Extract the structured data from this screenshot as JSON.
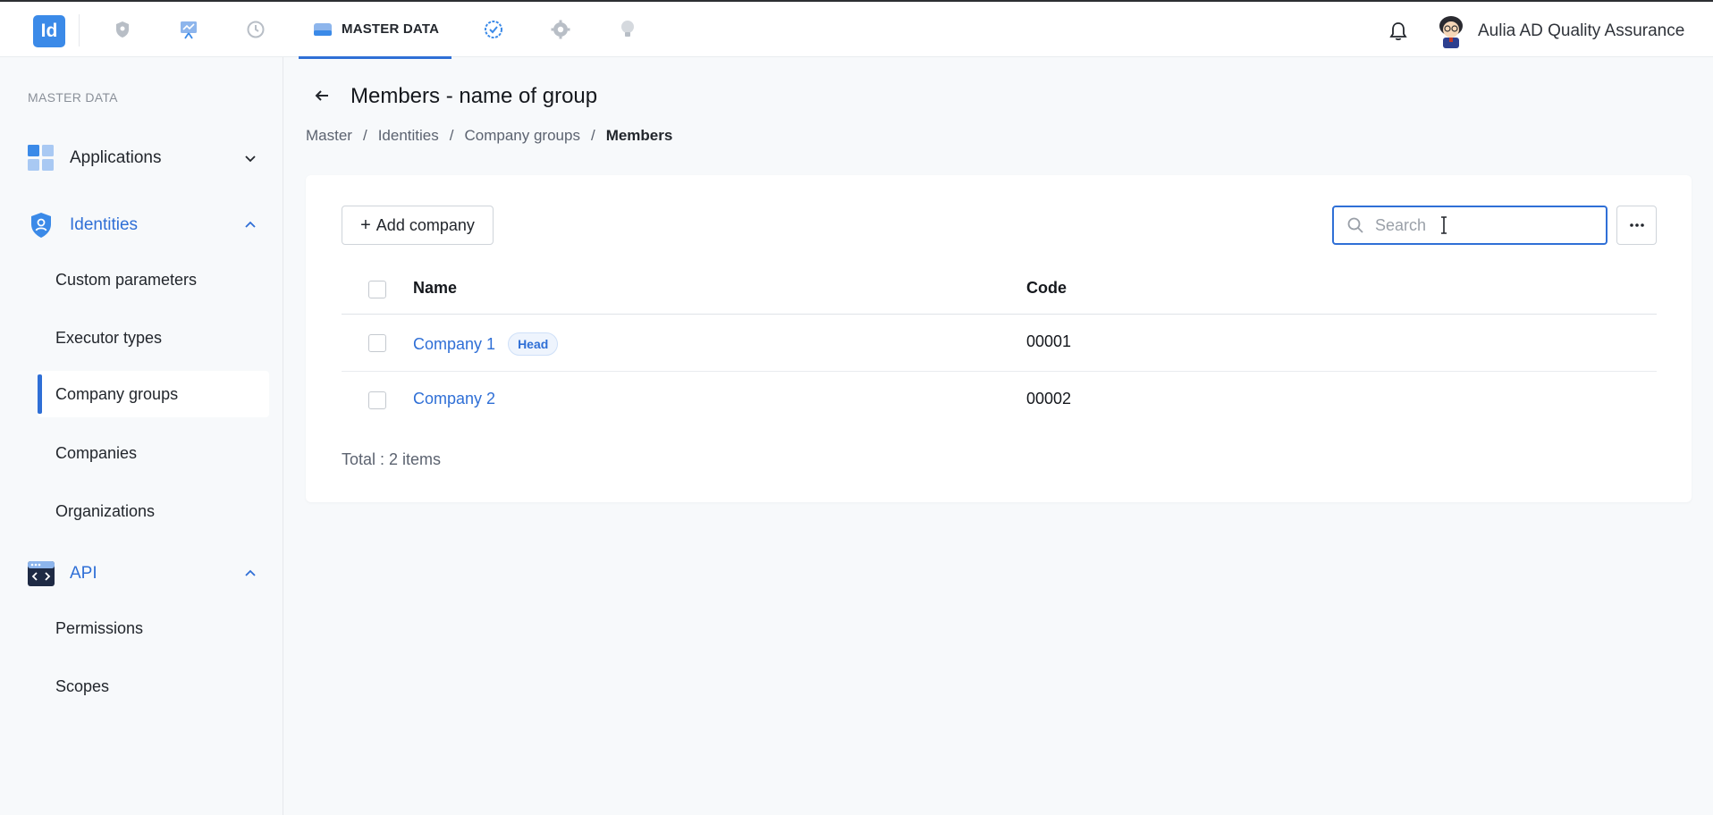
{
  "app": {
    "logo_text": "Id",
    "brand_color": "#3b8ae8",
    "accent_color": "#2f6fd6"
  },
  "topnav": {
    "icons": [
      "security-shield-icon",
      "dashboard-chart-icon",
      "history-clock-icon",
      "master-data-icon",
      "approval-check-icon",
      "settings-gear-icon",
      "idea-bulb-icon"
    ],
    "active_label": "MASTER DATA",
    "user_name": "Aulia AD Quality Assurance"
  },
  "sidebar": {
    "section_title": "MASTER DATA",
    "groups": [
      {
        "label": "Applications",
        "icon": "apps-grid-icon",
        "expanded": false,
        "items": []
      },
      {
        "label": "Identities",
        "icon": "identity-shield-icon",
        "expanded": true,
        "items": [
          {
            "label": "Custom parameters"
          },
          {
            "label": "Executor types"
          },
          {
            "label": "Company groups",
            "selected": true
          },
          {
            "label": "Companies"
          },
          {
            "label": "Organizations"
          }
        ]
      },
      {
        "label": "API",
        "icon": "api-code-icon",
        "expanded": true,
        "items": [
          {
            "label": "Permissions"
          },
          {
            "label": "Scopes"
          }
        ]
      }
    ]
  },
  "page": {
    "title": "Members - name of group",
    "breadcrumb": [
      "Master",
      "Identities",
      "Company groups",
      "Members"
    ]
  },
  "toolbar": {
    "add_label": "Add company",
    "search_placeholder": "Search",
    "search_value": ""
  },
  "table": {
    "columns": [
      "Name",
      "Code"
    ],
    "rows": [
      {
        "name": "Company 1",
        "badge": "Head",
        "code": "00001"
      },
      {
        "name": "Company 2",
        "badge": "",
        "code": "00002"
      }
    ],
    "total_text": "Total : 2 items"
  }
}
